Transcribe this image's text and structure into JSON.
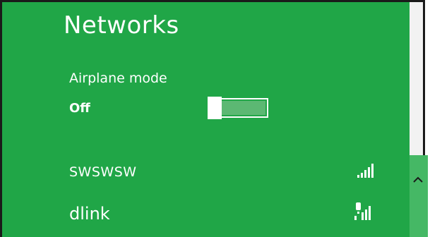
{
  "header": {
    "title": "Networks"
  },
  "airplane_mode": {
    "label": "Airplane mode",
    "state": "Off",
    "on_fraction": 0
  },
  "networks": [
    {
      "name": "SWSWSW",
      "signal_bars": 5,
      "secured": true
    },
    {
      "name": "dlink",
      "signal_bars": 4,
      "secured": false
    }
  ],
  "scroll": {
    "icon": "chevron-up-icon"
  },
  "colors": {
    "background": "#20a647",
    "text": "#ffffff"
  }
}
